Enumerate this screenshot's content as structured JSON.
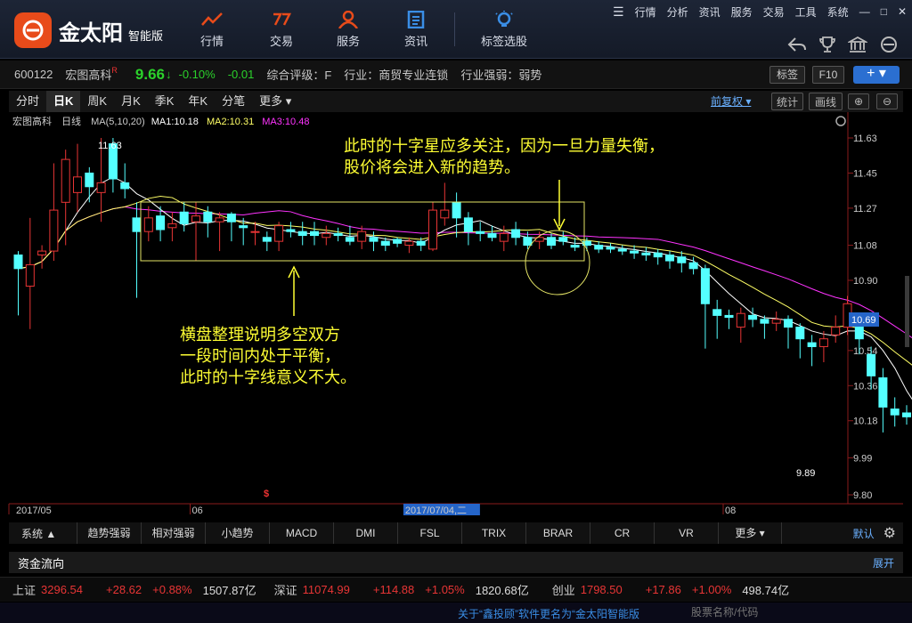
{
  "app": {
    "logo_text": "金太阳",
    "logo_sub": "智能版",
    "nav": [
      "行情",
      "交易",
      "服务",
      "资讯",
      "标签选股"
    ],
    "top_menu": [
      "行情",
      "分析",
      "资讯",
      "服务",
      "交易",
      "工具",
      "系统"
    ]
  },
  "stock": {
    "code": "600122",
    "name": "宏图高科",
    "badge": "R",
    "price": "9.66",
    "pct": "-0.10%",
    "chg": "-0.01",
    "rating": "综合评级：F",
    "industry": "行业：商贸专业连锁",
    "strength": "行业强弱：弱势",
    "btn_tag": "标签",
    "btn_f10": "F10",
    "btn_plus": "+ ▾"
  },
  "timeframes": [
    "分时",
    "日K",
    "周K",
    "月K",
    "季K",
    "年K",
    "分笔",
    "更多 ▾"
  ],
  "active_timeframe": "日K",
  "right_controls": {
    "adjust": "前复权 ▾",
    "stats": "统计",
    "draw": "画线"
  },
  "header": {
    "name": "宏图高科",
    "period": "日线",
    "ma_label": "MA(5,10,20)",
    "ma1": "MA1:10.18",
    "ma2": "MA2:10.31",
    "ma3": "MA3:10.48"
  },
  "annotations": {
    "top_line1": "此时的十字星应多关注，因为一旦力量失衡，",
    "top_line2": "股价将会进入新的趋势。",
    "left_line1": "横盘整理说明多空双方",
    "left_line2": "一段时间内处于平衡，",
    "left_line3": "此时的十字线意义不大。"
  },
  "chart_data": {
    "type": "candlestick",
    "y_ticks": [
      "11.63",
      "11.45",
      "11.27",
      "11.08",
      "10.90",
      "10.72",
      "10.54",
      "10.36",
      "10.18",
      "9.99",
      "9.80"
    ],
    "current_price_label": "10.69",
    "high_label": "11.63",
    "low_label": "9.89",
    "date_labels": [
      "2017/05",
      "06",
      "2017/07/04,二",
      "08"
    ],
    "ylim": [
      9.8,
      11.7
    ],
    "candles": [
      [
        11.03,
        10.96,
        11.05,
        10.72
      ],
      [
        10.87,
        10.98,
        11.22,
        10.65
      ],
      [
        11.03,
        11.05,
        11.08,
        10.96
      ],
      [
        11.05,
        11.26,
        11.5,
        11.0
      ],
      [
        11.3,
        11.52,
        11.57,
        11.08
      ],
      [
        11.35,
        11.43,
        11.6,
        11.25
      ],
      [
        11.45,
        11.38,
        11.48,
        11.3
      ],
      [
        11.35,
        11.4,
        11.63,
        11.2
      ],
      [
        11.6,
        11.42,
        11.63,
        11.35
      ],
      [
        11.4,
        11.37,
        11.5,
        11.32
      ],
      [
        11.22,
        11.15,
        11.3,
        10.81
      ],
      [
        11.15,
        11.22,
        11.28,
        11.1
      ],
      [
        11.23,
        11.16,
        11.28,
        11.1
      ],
      [
        11.17,
        11.19,
        11.25,
        11.1
      ],
      [
        11.25,
        11.19,
        11.3,
        11.15
      ],
      [
        11.2,
        11.23,
        11.3,
        11.0
      ],
      [
        11.25,
        11.2,
        11.28,
        11.12
      ],
      [
        11.2,
        11.22,
        11.25,
        11.05
      ],
      [
        11.24,
        11.2,
        11.25,
        11.1
      ],
      [
        11.18,
        11.17,
        11.22,
        11.08
      ],
      [
        11.15,
        11.15,
        11.2,
        11.08
      ],
      [
        11.12,
        11.1,
        11.15,
        11.05
      ],
      [
        11.1,
        11.18,
        11.2,
        11.05
      ],
      [
        11.16,
        11.15,
        11.2,
        11.12
      ],
      [
        11.15,
        11.13,
        11.2,
        11.08
      ],
      [
        11.15,
        11.13,
        11.2,
        11.08
      ],
      [
        11.12,
        11.14,
        11.18,
        11.08
      ],
      [
        11.14,
        11.13,
        11.17,
        11.1
      ],
      [
        11.12,
        11.1,
        11.18,
        11.08
      ],
      [
        11.1,
        11.15,
        11.18,
        11.06
      ],
      [
        11.12,
        11.1,
        11.15,
        11.05
      ],
      [
        11.1,
        11.08,
        11.12,
        11.05
      ],
      [
        11.11,
        11.09,
        11.12,
        11.07
      ],
      [
        11.08,
        11.1,
        11.12,
        11.04
      ],
      [
        11.1,
        11.08,
        11.12,
        11.05
      ],
      [
        11.06,
        11.26,
        11.3,
        11.05
      ],
      [
        11.22,
        11.26,
        11.4,
        11.18
      ],
      [
        11.3,
        11.22,
        11.35,
        11.12
      ],
      [
        11.22,
        11.15,
        11.25,
        11.08
      ],
      [
        11.15,
        11.14,
        11.2,
        11.1
      ],
      [
        11.14,
        11.12,
        11.18,
        11.1
      ],
      [
        11.1,
        11.14,
        11.18,
        11.05
      ],
      [
        11.16,
        11.12,
        11.2,
        11.08
      ],
      [
        11.12,
        11.08,
        11.15,
        11.06
      ],
      [
        11.1,
        11.12,
        11.15,
        11.06
      ],
      [
        11.12,
        11.08,
        11.14,
        11.06
      ],
      [
        11.12,
        11.1,
        11.15,
        11.08
      ],
      [
        11.08,
        11.07,
        11.12,
        11.05
      ],
      [
        11.1,
        11.08,
        11.12,
        11.05
      ],
      [
        11.08,
        11.06,
        11.1,
        11.04
      ],
      [
        11.07,
        11.06,
        11.09,
        11.04
      ],
      [
        11.06,
        11.05,
        11.08,
        11.03
      ],
      [
        11.05,
        11.04,
        11.08,
        11.01
      ],
      [
        11.04,
        11.03,
        11.07,
        11.0
      ],
      [
        11.04,
        11.02,
        11.06,
        10.98
      ],
      [
        11.03,
        11.0,
        11.05,
        10.96
      ],
      [
        11.02,
        10.99,
        11.05,
        10.94
      ],
      [
        10.99,
        10.96,
        11.02,
        10.93
      ],
      [
        10.96,
        10.78,
        10.98,
        10.55
      ],
      [
        10.75,
        10.72,
        10.8,
        10.6
      ],
      [
        10.72,
        10.71,
        10.75,
        10.65
      ],
      [
        10.66,
        10.73,
        10.76,
        10.58
      ],
      [
        10.72,
        10.7,
        10.76,
        10.66
      ],
      [
        10.7,
        10.68,
        10.72,
        10.6
      ],
      [
        10.68,
        10.7,
        10.74,
        10.64
      ],
      [
        10.7,
        10.66,
        10.72,
        10.55
      ],
      [
        10.66,
        10.6,
        10.68,
        10.5
      ],
      [
        10.58,
        10.56,
        10.62,
        10.46
      ],
      [
        10.56,
        10.6,
        10.64,
        10.48
      ],
      [
        10.62,
        10.66,
        10.72,
        10.58
      ],
      [
        10.66,
        10.78,
        10.82,
        10.62
      ],
      [
        10.66,
        10.6,
        10.68,
        10.52
      ],
      [
        10.52,
        10.41,
        10.56,
        10.34
      ],
      [
        10.4,
        10.25,
        10.45,
        10.12
      ],
      [
        10.24,
        10.21,
        10.3,
        10.15
      ],
      [
        10.22,
        10.2,
        10.26,
        10.16
      ],
      [
        10.2,
        10.13,
        10.24,
        10.08
      ],
      [
        10.14,
        10.16,
        10.2,
        10.1
      ],
      [
        10.16,
        10.12,
        10.2,
        10.08
      ],
      [
        10.12,
        10.1,
        10.15,
        10.06
      ],
      [
        10.24,
        10.08,
        10.26,
        10.05
      ],
      [
        10.1,
        10.02,
        10.14,
        9.89
      ]
    ]
  },
  "indicator_tabs": {
    "group": "系统 ▲",
    "tabs": [
      "趋势强弱",
      "相对强弱",
      "小趋势",
      "MACD",
      "DMI",
      "FSL",
      "TRIX",
      "BRAR",
      "CR",
      "VR",
      "更多 ▾"
    ],
    "default": "默认"
  },
  "fund_flow": {
    "label": "资金流向",
    "expand": "展开"
  },
  "indices": [
    {
      "name": "上证",
      "value": "3296.54",
      "chg": "+28.62",
      "pct": "+0.88%",
      "amount": "1507.87亿"
    },
    {
      "name": "深证",
      "value": "11074.99",
      "chg": "+114.88",
      "pct": "+1.05%",
      "amount": "1820.68亿"
    },
    {
      "name": "创业",
      "value": "1798.50",
      "chg": "+17.86",
      "pct": "+1.00%",
      "amount": "498.74亿"
    }
  ],
  "footer": {
    "notice": "关于“鑫投顾”软件更名为“金太阳智能版",
    "search_placeholder": "股票名称/代码"
  },
  "colors": {
    "up": "#e83535",
    "down": "#54ffff",
    "ma1": "#ffffff",
    "ma2": "#ffff66",
    "ma3": "#ff33ff",
    "annotation": "#ffff33"
  }
}
